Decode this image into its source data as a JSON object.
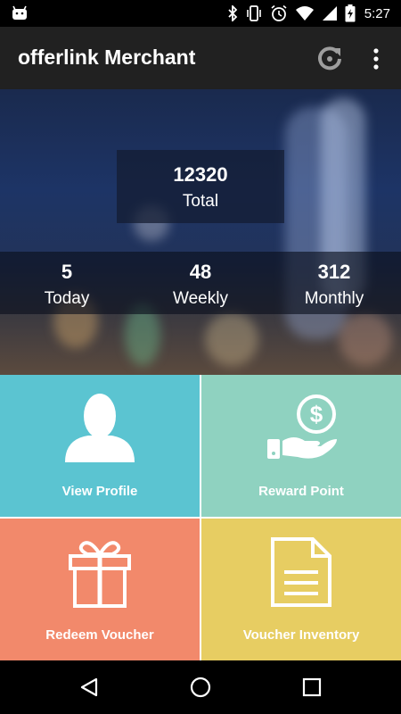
{
  "status_bar": {
    "time": "5:27",
    "icons": [
      "android-icon",
      "bluetooth-icon",
      "vibrate-icon",
      "alarm-icon",
      "wifi-icon",
      "signal-icon",
      "battery-charging-icon"
    ]
  },
  "app_bar": {
    "title": "offerlink Merchant",
    "actions": [
      "refresh-icon",
      "overflow-menu-icon"
    ]
  },
  "summary": {
    "total_value": "12320",
    "total_label": "Total",
    "today_value": "5",
    "today_label": "Today",
    "weekly_value": "48",
    "weekly_label": "Weekly",
    "monthly_value": "312",
    "monthly_label": "Monthly"
  },
  "tiles": {
    "view_profile": "View Profile",
    "reward_point": "Reward Point",
    "redeem_voucher": "Redeem Voucher",
    "voucher_inventory": "Voucher Inventory"
  },
  "colors": {
    "app_bar": "#212121",
    "profile_tile": "#5bc4d1",
    "reward_tile": "#8fd2c0",
    "redeem_tile": "#f2896b",
    "inventory_tile": "#e7cd62"
  },
  "nav_bar": [
    "back-icon",
    "home-icon",
    "recents-icon"
  ]
}
